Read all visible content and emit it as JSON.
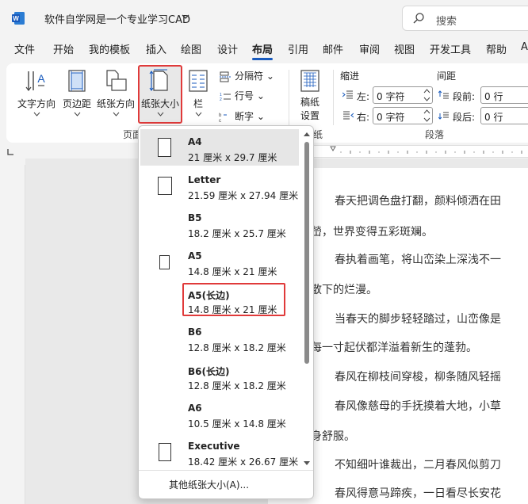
{
  "app": {
    "title": "软件自学网是一个专业学习CAD",
    "search_placeholder": "搜索"
  },
  "tabs": [
    "文件",
    "开始",
    "我的模板",
    "插入",
    "绘图",
    "设计",
    "布局",
    "引用",
    "邮件",
    "审阅",
    "视图",
    "开发工具",
    "帮助",
    "A"
  ],
  "active_tab": "布局",
  "ribbon": {
    "text_direction": "文字方向",
    "margins": "页边距",
    "orientation": "纸张方向",
    "size": "纸张大小",
    "columns": "栏",
    "breaks": "分隔符",
    "line_numbers": "行号",
    "hyphenation": "断字",
    "draft_paper": "稿纸",
    "draft_settings": "设置",
    "indent_title": "缩进",
    "spacing_title": "间距",
    "left_label": "左:",
    "right_label": "右:",
    "before_label": "段前:",
    "after_label": "段后:",
    "left_value": "0 字符",
    "right_value": "0 字符",
    "before_value": "0 行",
    "after_value": "0 行",
    "group_page_setup": "页面",
    "group_draft": "纸",
    "group_paragraph": "段落"
  },
  "paper_sizes": [
    {
      "name": "A4",
      "dims": "21 厘米 x 29.7 厘米"
    },
    {
      "name": "Letter",
      "dims": "21.59 厘米 x 27.94 厘米"
    },
    {
      "name": "B5",
      "dims": "18.2 厘米 x 25.7 厘米"
    },
    {
      "name": "A5",
      "dims": "14.8 厘米 x 21 厘米"
    },
    {
      "name": "A5(长边)",
      "dims": "14.8 厘米 x 21 厘米"
    },
    {
      "name": "B6",
      "dims": "12.8 厘米 x 18.2 厘米"
    },
    {
      "name": "B6(长边)",
      "dims": "12.8 厘米 x 18.2 厘米"
    },
    {
      "name": "A6",
      "dims": "10.5 厘米 x 14.8 厘米"
    },
    {
      "name": "Executive",
      "dims": "18.42 厘米 x 26.67 厘米"
    }
  ],
  "more_sizes": "其他纸张大小(A)...",
  "document": {
    "lines": [
      "春天把调色盘打翻，颜料倾洒在田",
      "嵤，世界变得五彩斑斓。",
      "春执着画笔，将山峦染上深浅不一",
      "散下的烂漫。",
      "当春天的脚步轻轻踏过，山峦像是",
      "每一寸起伏都洋溢着新生的蓬勃。",
      "春风在柳枝间穿梭，柳条随风轻摇",
      "春风像慈母的手抚摸着大地，小草",
      "身舒服。",
      "不知细叶谁裁出，二月春风似剪刀",
      "春风得意马蹄疾，一日看尽长安花"
    ]
  },
  "colors": {
    "accent": "#185abd",
    "highlight": "#e03a3a"
  }
}
